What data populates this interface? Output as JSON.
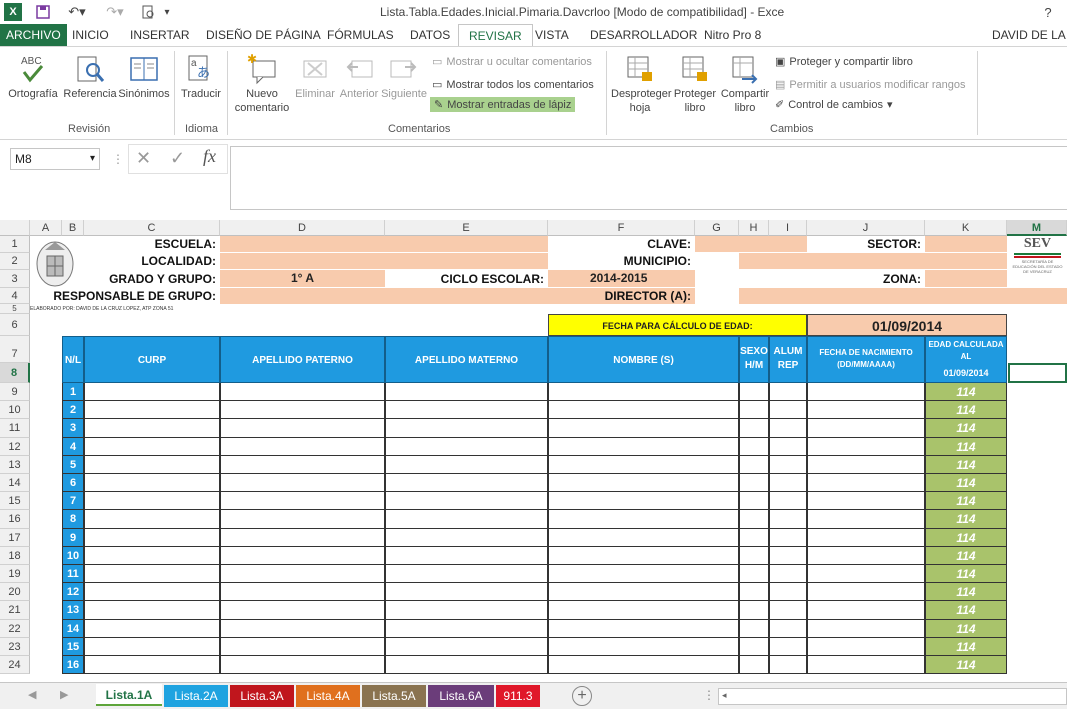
{
  "window": {
    "title": "Lista.Tabla.Edades.Inicial.Pimaria.Davcrloo  [Modo de compatibilidad] - Exce",
    "help": "?",
    "user": "DAVID DE LA C"
  },
  "ribbon_tabs": [
    "ARCHIVO",
    "INICIO",
    "INSERTAR",
    "DISEÑO DE PÁGINA",
    "FÓRMULAS",
    "DATOS",
    "REVISAR",
    "VISTA",
    "DESARROLLADOR",
    "Nitro Pro 8"
  ],
  "ribbon": {
    "groups": {
      "revision": "Revisión",
      "idioma": "Idioma",
      "comentarios": "Comentarios",
      "cambios": "Cambios"
    },
    "buttons": {
      "ortografia": "Ortografía",
      "referencia": "Referencia",
      "sinonimos": "Sinónimos",
      "traducir": "Traducir",
      "nuevo": "Nuevo comentario",
      "eliminar": "Eliminar",
      "anterior": "Anterior",
      "siguiente": "Siguiente",
      "mostrar_ocultar": "Mostrar u ocultar comentarios",
      "mostrar_todos": "Mostrar todos los comentarios",
      "mostrar_lapiz": "Mostrar entradas de lápiz",
      "desproteger_hoja": "Desproteger hoja",
      "proteger_libro": "Proteger libro",
      "compartir_libro": "Compartir libro",
      "proteger_compartir": "Proteger y compartir libro",
      "permitir": "Permitir a usuarios modificar rangos",
      "control": "Control de cambios"
    }
  },
  "formula_bar": {
    "name_box": "M8",
    "fx": "fx"
  },
  "columns": [
    "A",
    "B",
    "C",
    "D",
    "E",
    "F",
    "G",
    "H",
    "I",
    "J",
    "K",
    "M"
  ],
  "form": {
    "escuela": "ESCUELA:",
    "localidad": "LOCALIDAD:",
    "grado": "GRADO Y GRUPO:",
    "responsable": "RESPONSABLE DE GRUPO:",
    "grado_value": "1° A",
    "ciclo": "CICLO ESCOLAR:",
    "ciclo_value": "2014-2015",
    "clave": "CLAVE:",
    "municipio": "MUNICIPIO:",
    "director": "DIRECTOR (A):",
    "sector": "SECTOR:",
    "zona": "ZONA:",
    "credits": "ELABORADO POR: DAVID DE LA CRUZ LOPEZ, ATP ZONA 51",
    "sev": "SEV",
    "sev_sub": "SECRETARÍA DE EDUCACIÓN DEL ESTADO DE VERACRUZ",
    "fecha_calc": "FECHA PARA CÁLCULO DE EDAD:",
    "fecha_value": "01/09/2014"
  },
  "table_headers": {
    "nl": "N/L",
    "curp": "CURP",
    "paterno": "APELLIDO PATERNO",
    "materno": "APELLIDO MATERNO",
    "nombre": "NOMBRE (S)",
    "sexo": "SEXO H/M",
    "alum": "ALUM REP",
    "nacimiento": "FECHA DE NACIMIENTO (DD/MM/AAAA)",
    "edad": "EDAD CALCULADA AL",
    "edad_date": "01/09/2014"
  },
  "row_numbers": [
    "1",
    "2",
    "3",
    "4",
    "5",
    "6",
    "7",
    "8",
    "9",
    "10",
    "11",
    "12",
    "13",
    "14",
    "15",
    "16",
    "17",
    "18",
    "19",
    "20",
    "21",
    "22",
    "23",
    "24"
  ],
  "rows": [
    {
      "n": "1",
      "edad": "114"
    },
    {
      "n": "2",
      "edad": "114"
    },
    {
      "n": "3",
      "edad": "114"
    },
    {
      "n": "4",
      "edad": "114"
    },
    {
      "n": "5",
      "edad": "114"
    },
    {
      "n": "6",
      "edad": "114"
    },
    {
      "n": "7",
      "edad": "114"
    },
    {
      "n": "8",
      "edad": "114"
    },
    {
      "n": "9",
      "edad": "114"
    },
    {
      "n": "10",
      "edad": "114"
    },
    {
      "n": "11",
      "edad": "114"
    },
    {
      "n": "12",
      "edad": "114"
    },
    {
      "n": "13",
      "edad": "114"
    },
    {
      "n": "14",
      "edad": "114"
    },
    {
      "n": "15",
      "edad": "114"
    },
    {
      "n": "16",
      "edad": "114"
    }
  ],
  "sheets": [
    {
      "name": "Lista.1A",
      "color": "#ffffff",
      "active": true
    },
    {
      "name": "Lista.2A",
      "color": "#1fa3e0"
    },
    {
      "name": "Lista.3A",
      "color": "#c0161d"
    },
    {
      "name": "Lista.4A",
      "color": "#e0701e"
    },
    {
      "name": "Lista.5A",
      "color": "#8a7350"
    },
    {
      "name": "Lista.6A",
      "color": "#6b3d7a"
    },
    {
      "name": "911.3",
      "color": "#e0182a"
    }
  ]
}
